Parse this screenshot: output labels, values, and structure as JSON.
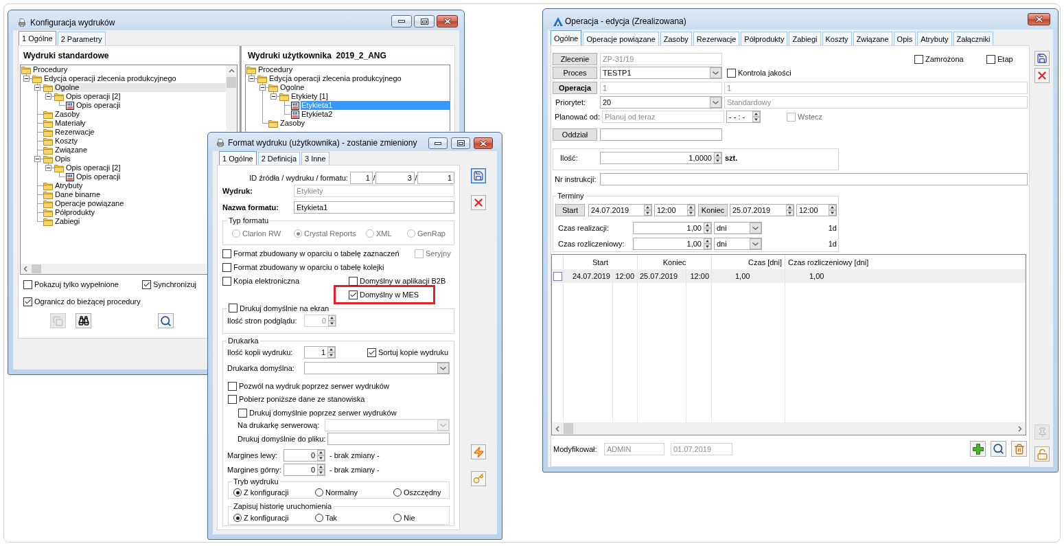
{
  "config_window": {
    "title": "Konfiguracja wydruków",
    "tabs": [
      {
        "label": "1 Ogólne",
        "selected": true
      },
      {
        "label": "2 Parametry",
        "selected": false
      }
    ],
    "standard_prints": {
      "heading": "Wydruki standardowe",
      "focused": false,
      "tree": [
        {
          "label": "Procedury",
          "kind": "folder",
          "selected": false,
          "children": [
            {
              "label": "Edycja operacji zlecenia produkcyjnego",
              "kind": "folder",
              "selected": false,
              "expanded": true,
              "children": [
                {
                  "label": "Ogolne",
                  "kind": "folder",
                  "selected": true,
                  "expanded": true,
                  "children": [
                    {
                      "label": "Opis operacji [2]",
                      "kind": "folder",
                      "selected": false,
                      "expanded": true,
                      "children": [
                        {
                          "label": "Opis operacji",
                          "kind": "report",
                          "selected": false
                        }
                      ]
                    }
                  ]
                },
                {
                  "label": "Zasoby",
                  "kind": "folder",
                  "selected": false
                },
                {
                  "label": "Materiały",
                  "kind": "folder",
                  "selected": false
                },
                {
                  "label": "Rezerwacje",
                  "kind": "folder",
                  "selected": false
                },
                {
                  "label": "Koszty",
                  "kind": "folder",
                  "selected": false
                },
                {
                  "label": "Związane",
                  "kind": "folder",
                  "selected": false
                },
                {
                  "label": "Opis",
                  "kind": "folder",
                  "selected": false,
                  "expanded": true,
                  "children": [
                    {
                      "label": "Opis operacji [2]",
                      "kind": "folder",
                      "selected": false,
                      "expanded": true,
                      "children": [
                        {
                          "label": "Opis operacji",
                          "kind": "report",
                          "selected": false
                        }
                      ]
                    }
                  ]
                },
                {
                  "label": "Atrybuty",
                  "kind": "folder",
                  "selected": false
                },
                {
                  "label": "Dane binarne",
                  "kind": "folder",
                  "selected": false
                },
                {
                  "label": "Operacje powiązane",
                  "kind": "folder",
                  "selected": false
                },
                {
                  "label": "Półprodukty",
                  "kind": "folder",
                  "selected": false
                },
                {
                  "label": "Zabiegi",
                  "kind": "folder",
                  "selected": false
                }
              ]
            }
          ]
        }
      ]
    },
    "user_prints": {
      "heading": "Wydruki użytkownika  2019_2_ANG",
      "focused": true,
      "tree": [
        {
          "label": "Procedury",
          "kind": "folder",
          "selected": false,
          "children": [
            {
              "label": "Edycja operacji zlecenia produkcyjnego",
              "kind": "folder",
              "selected": false,
              "expanded": true,
              "children": [
                {
                  "label": "Ogolne",
                  "kind": "folder",
                  "selected": false,
                  "expanded": true,
                  "children": [
                    {
                      "label": "Etykiety [1]",
                      "kind": "folder",
                      "selected": false,
                      "expanded": true,
                      "children": [
                        {
                          "label": "Etykieta1",
                          "kind": "report",
                          "selected": true
                        },
                        {
                          "label": "Etykieta2",
                          "kind": "report",
                          "selected": false
                        }
                      ]
                    }
                  ]
                },
                {
                  "label": "Zasoby",
                  "kind": "folder",
                  "selected": false
                }
              ]
            }
          ]
        }
      ]
    },
    "options": [
      {
        "label": "Pokazuj tylko wypełnione",
        "checked": false
      },
      {
        "label": "Synchronizuj",
        "checked": true
      },
      {
        "label": "Ogranicz do bieżącej procedury",
        "checked": true
      }
    ],
    "tools": [
      {
        "kind": "copy",
        "disabled": true
      },
      {
        "kind": "binoculars",
        "disabled": false
      },
      {
        "kind": "search",
        "disabled": false
      }
    ]
  },
  "format_window": {
    "title": "Format wydruku (użytkownika) - zostanie zmieniony",
    "tabs": [
      {
        "label": "1 Ogólne",
        "selected": true
      },
      {
        "label": "2 Definicja",
        "selected": false
      },
      {
        "label": "3 Inne",
        "selected": false
      }
    ],
    "ids": {
      "label": "ID źródła / wydruku / formatu:",
      "values": [
        "1",
        "3",
        "1"
      ],
      "separators": [
        "/",
        "/"
      ]
    },
    "print": {
      "label": "Wydruk:",
      "value": "Etykiety",
      "disabled": true
    },
    "format_name": {
      "label": "Nazwa formatu:",
      "value": "Etykieta1"
    },
    "format_type": {
      "title": "Typ formatu",
      "disabled": true,
      "options": [
        {
          "label": "Clarion RW",
          "selected": false
        },
        {
          "label": "Crystal Reports",
          "selected": true
        },
        {
          "label": "XML",
          "selected": false
        },
        {
          "label": "GenRap",
          "selected": false
        }
      ]
    },
    "selection_table": {
      "label": "Format zbudowany w oparciu o tabelę zaznaczeń",
      "checked": false
    },
    "serial": {
      "label": "Seryjny",
      "checked": false,
      "disabled": true
    },
    "queue_table": {
      "label": "Format zbudowany w oparciu o tabelę kolejki",
      "checked": false
    },
    "electronic_copy": {
      "label": "Kopia elektroniczna",
      "checked": false
    },
    "default_b2b": {
      "label": "Domyślny w aplikacji B2B",
      "checked": false
    },
    "default_mes": {
      "label": "Domyślny w MES",
      "checked": true,
      "highlighted": true
    },
    "screen_preview": {
      "label": "Drukuj domyślnie na ekran",
      "checked": false
    },
    "preview_pages": {
      "label": "Ilość stron podglądu:",
      "value": "0",
      "disabled": true
    },
    "printer": {
      "title": "Drukarka",
      "copies": {
        "label": "Ilość kopii wydruku:",
        "value": "1"
      },
      "sort_copies": {
        "label": "Sortuj kopie wydruku",
        "checked": true
      },
      "default_printer": {
        "label": "Drukarka domyślna:"
      },
      "server_print": {
        "label": "Pozwól na wydruk poprzez serwer wydruków",
        "checked": false
      },
      "station_data": {
        "label": "Pobierz poniższe dane ze stanowiska",
        "checked": false
      },
      "server_default": {
        "label": "Drukuj domyślnie poprzez serwer wydruków",
        "checked": false
      },
      "server_printer": {
        "label": "Na drukarkę serwerową:",
        "disabled": true
      },
      "file_default": {
        "label": "Drukuj domyślnie do pliku:"
      },
      "margins": [
        {
          "label": "Margines lewy:",
          "value": "0",
          "note": "- brak zmiany -"
        },
        {
          "label": "Margines górny:",
          "value": "0",
          "note": "- brak zmiany -"
        }
      ],
      "print_mode": {
        "title": "Tryb wydruku",
        "options": [
          {
            "label": "Z konfiguracji",
            "selected": true
          },
          {
            "label": "Normalny",
            "selected": false
          },
          {
            "label": "Oszczędny",
            "selected": false
          }
        ]
      },
      "history": {
        "title": "Zapisuj historię uruchomienia",
        "options": [
          {
            "label": "Z konfiguracji",
            "selected": true
          },
          {
            "label": "Tak",
            "selected": false
          },
          {
            "label": "Nie",
            "selected": false
          }
        ]
      }
    },
    "side_tools": {
      "top": [
        {
          "kind": "save",
          "focused": true
        },
        {
          "kind": "delete",
          "focused": false
        }
      ],
      "bottom": [
        {
          "kind": "lightning",
          "focused": false
        },
        {
          "kind": "key",
          "focused": false
        }
      ]
    }
  },
  "operation_window": {
    "title": "Operacja - edycja (Zrealizowana)",
    "tabs": [
      {
        "label": "Ogólne",
        "selected": true
      },
      {
        "label": "Operacje powiązane",
        "selected": false
      },
      {
        "label": "Zasoby",
        "selected": false
      },
      {
        "label": "Rezerwacje",
        "selected": false
      },
      {
        "label": "Półprodukty",
        "selected": false
      },
      {
        "label": "Zabiegi",
        "selected": false
      },
      {
        "label": "Koszty",
        "selected": false
      },
      {
        "label": "Związane",
        "selected": false
      },
      {
        "label": "Opis",
        "selected": false
      },
      {
        "label": "Atrybuty",
        "selected": false
      },
      {
        "label": "Załączniki",
        "selected": false
      }
    ],
    "order": {
      "button": "Zlecenie",
      "field": {
        "value": "ZP-31/19",
        "disabled": true
      }
    },
    "frozen": {
      "label": "Zamrożona",
      "checked": false
    },
    "stage": {
      "label": "Etap",
      "checked": false
    },
    "process": {
      "button": "Proces",
      "field": {
        "value": "TESTP1"
      }
    },
    "quality_control": {
      "label": "Kontrola jakości",
      "checked": false
    },
    "operation": {
      "button": "Operacja",
      "code": {
        "value": "1",
        "disabled": true
      },
      "name": {
        "value": "1",
        "disabled": true
      }
    },
    "priority": {
      "label": "Priorytet:",
      "field": {
        "value": "20"
      },
      "description": {
        "value": "Standardowy",
        "disabled": true
      }
    },
    "plan_from": {
      "label": "Planować od:",
      "field": {
        "value": "Planuj od teraz",
        "disabled": true
      },
      "time": {
        "value": "- - : -"
      }
    },
    "backwards": {
      "label": "Wstecz",
      "checked": false,
      "disabled": true
    },
    "department": {
      "button": "Oddział"
    },
    "quantity": {
      "label": "Ilość:",
      "field": {
        "value": "1,0000"
      },
      "unit": "szt."
    },
    "instruction": {
      "label": "Nr instrukcji:"
    },
    "schedule": {
      "title": "Terminy",
      "start": {
        "button": "Start",
        "date": "24.07.2019",
        "time": "12:00"
      },
      "end": {
        "button": "Koniec",
        "date": "25.07.2019",
        "time": "12:00"
      },
      "durations": [
        {
          "label": "Czas realizacji:",
          "value": "1,00",
          "unit": "dni",
          "summary": "1d"
        },
        {
          "label": "Czas rozliczeniowy:",
          "value": "1,00",
          "unit": "dni",
          "summary": "1d"
        }
      ]
    },
    "table": {
      "columns": [
        "Start",
        "",
        "Koniec",
        "",
        "Czas [dni]",
        "Czas rozliczeniowy [dni]"
      ],
      "rows": [
        {
          "checked": false,
          "selected": true,
          "cells": [
            "24.07.2019",
            "12:00",
            "25.07.2019",
            "12:00",
            "1,00",
            "1,00"
          ]
        }
      ]
    },
    "modified": {
      "label": "Modyfikował:",
      "user": {
        "value": "ADMIN",
        "disabled": true
      },
      "date": {
        "value": "01.07.2019",
        "disabled": true
      }
    },
    "table_tools": [
      {
        "kind": "add"
      },
      {
        "kind": "search"
      },
      {
        "kind": "trash"
      }
    ],
    "side_tools": {
      "top": [
        {
          "kind": "save"
        },
        {
          "kind": "delete"
        }
      ],
      "bottom": [
        {
          "kind": "pin",
          "disabled": true
        },
        {
          "kind": "lock",
          "disabled": false
        }
      ]
    }
  }
}
